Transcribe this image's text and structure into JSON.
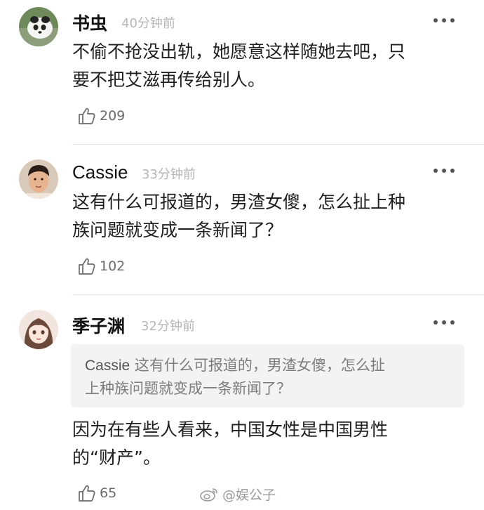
{
  "comments": [
    {
      "username": "书虫",
      "time": "40分钟前",
      "text_lines": [
        "不偷不抢没出轨，她愿意这样随她去吧，只",
        "要不把艾滋再传给别人。"
      ],
      "likes": "209"
    },
    {
      "username": "Cassie",
      "time": "33分钟前",
      "text_lines": [
        "这有什么可报道的，男渣女傻，怎么扯上种",
        "族问题就变成一条新闻了？"
      ],
      "likes": "102"
    },
    {
      "username": "季子渊",
      "time": "32分钟前",
      "quote": {
        "author": "Cassie",
        "line1": "这有什么可报道的，男渣女傻，怎么扯",
        "line2": "上种族问题就变成一条新闻了？"
      },
      "text_lines": [
        "因为在有些人看来，中国女性是中国男性",
        "的“财产”。"
      ],
      "likes": "65"
    }
  ],
  "watermark": "@娱公子",
  "colors": {
    "username": "#111111",
    "time": "#b6b6b6",
    "quote_bg": "#f3f3f3",
    "quote_text": "#7d7d7d"
  },
  "icons": [
    "thumbs-up-icon",
    "more-dots-icon",
    "weibo-icon"
  ]
}
